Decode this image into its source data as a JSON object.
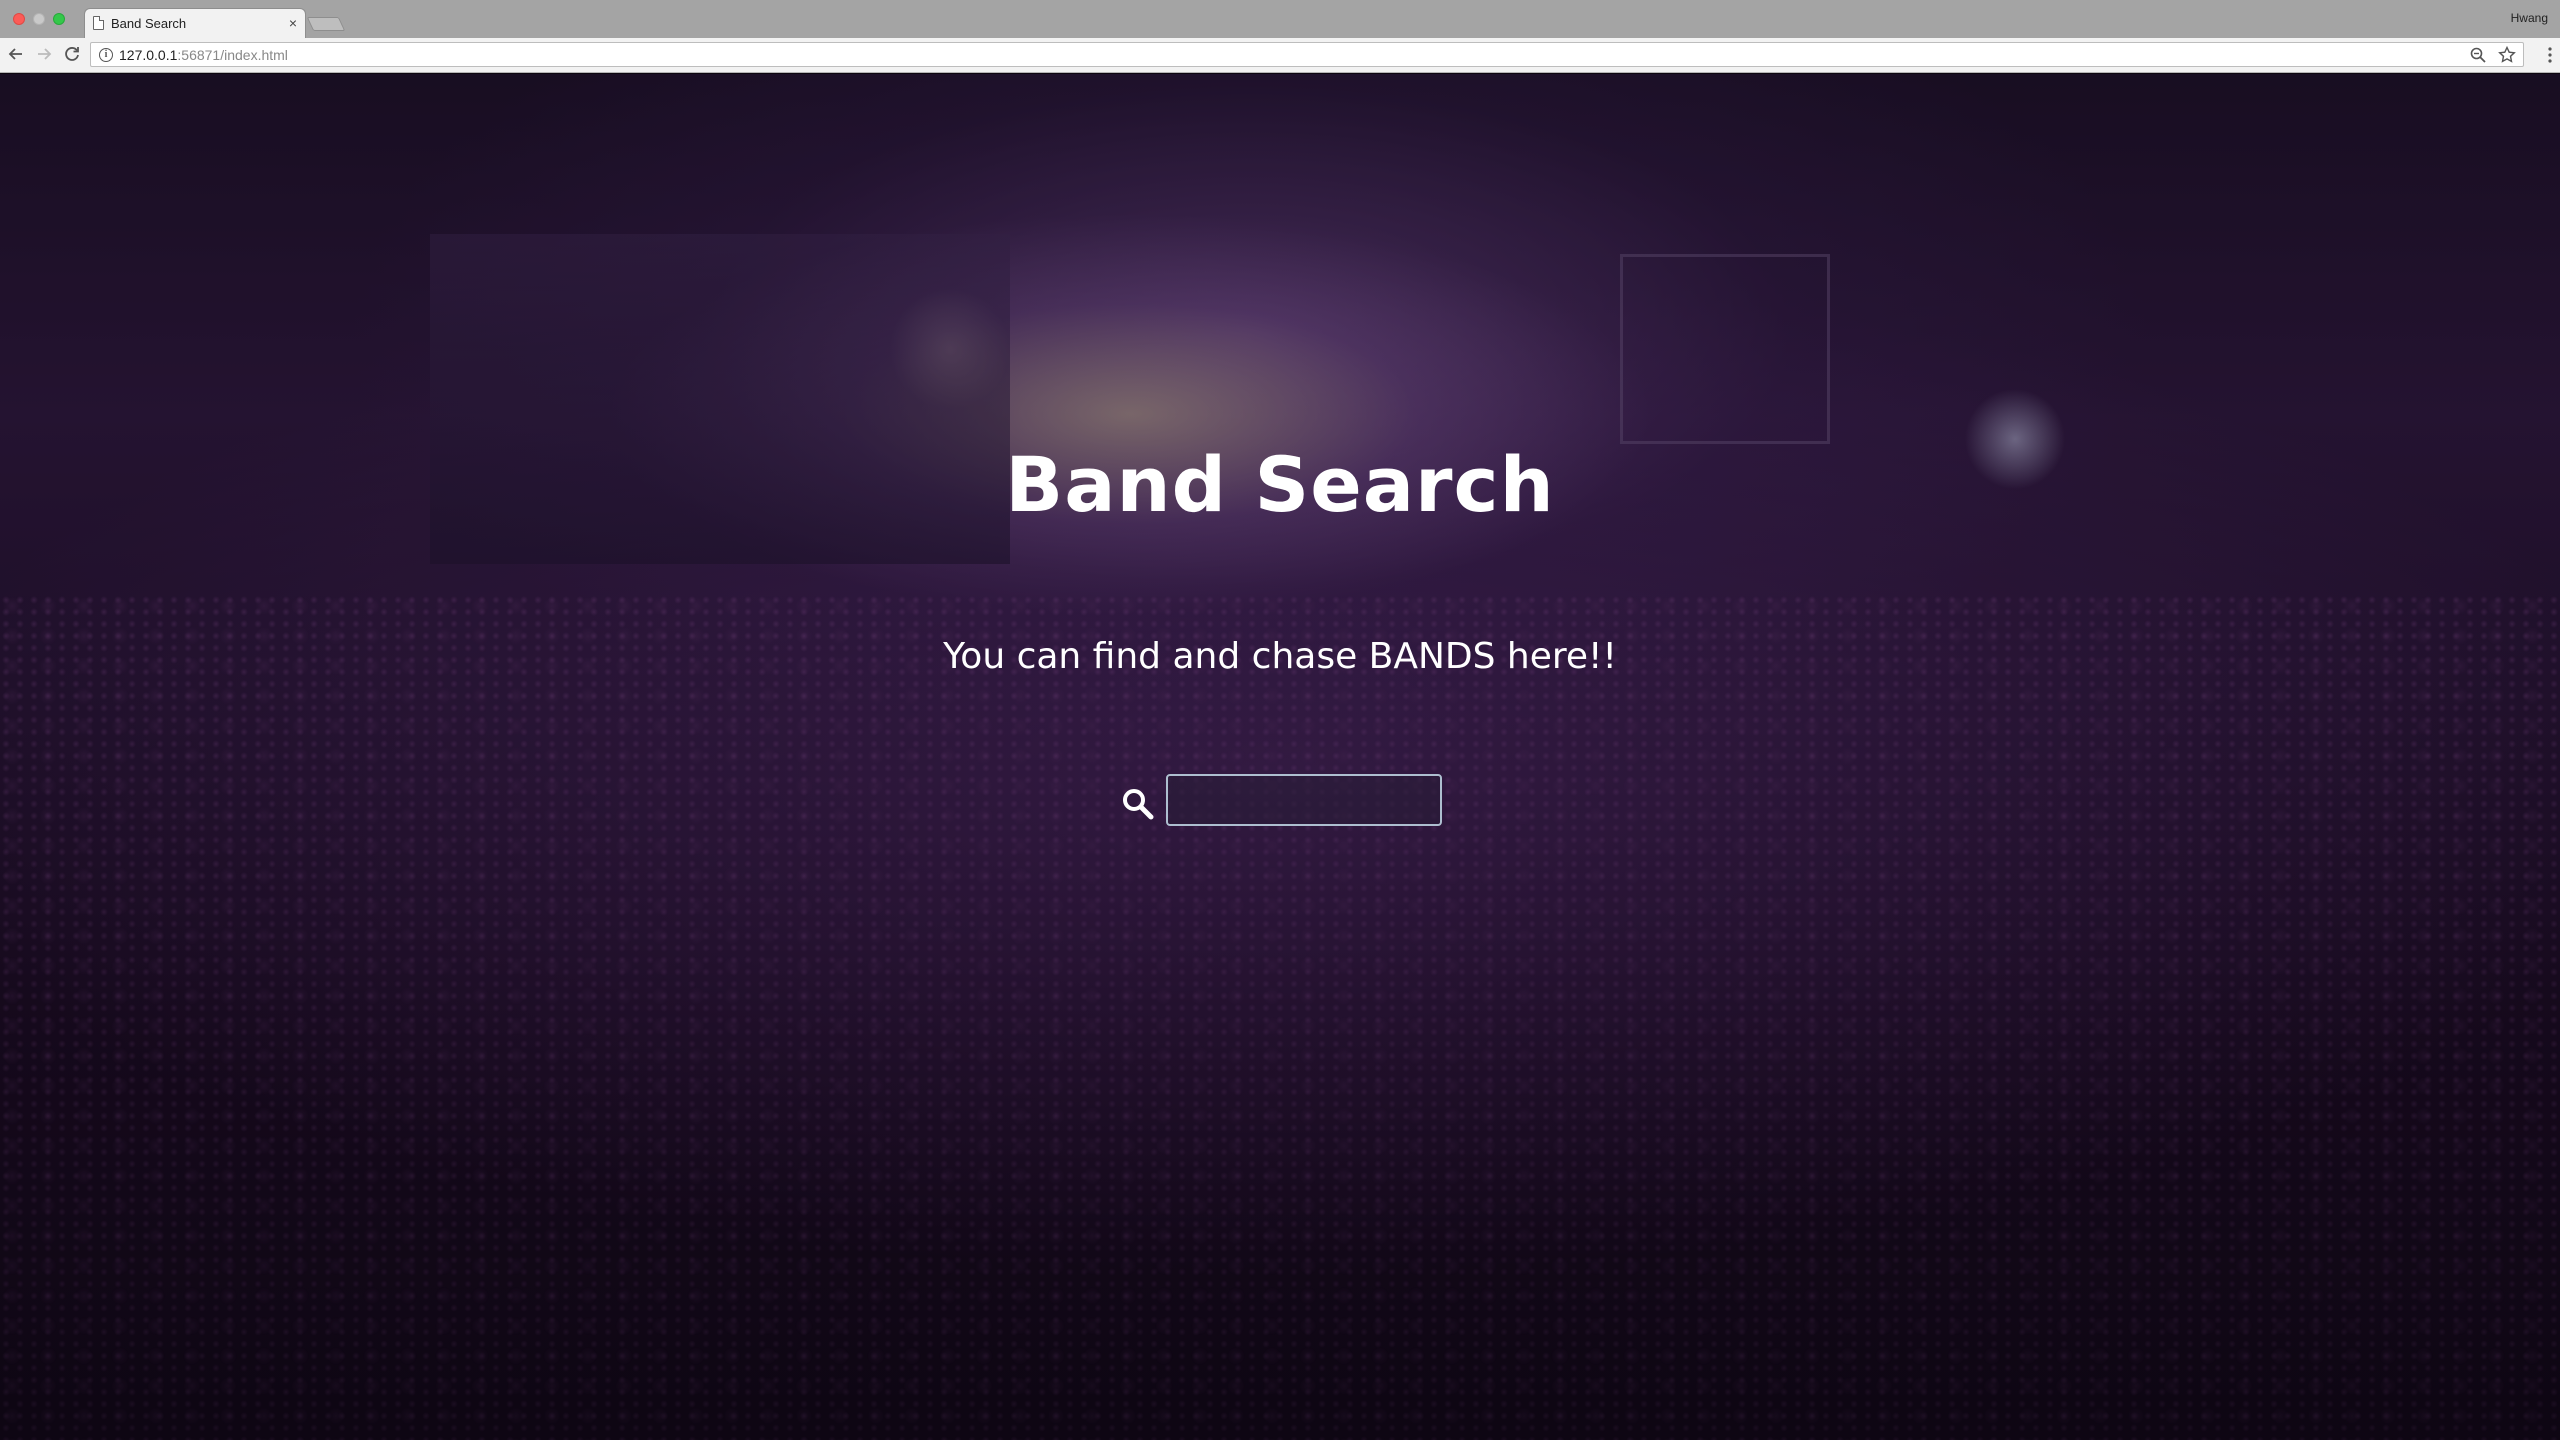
{
  "browser": {
    "tab_title": "Band Search",
    "tab_close_glyph": "×",
    "profile_name": "Hwang",
    "url_host": "127.0.0.1",
    "url_rest": ":56871/index.html",
    "info_glyph": "i"
  },
  "page": {
    "title": "Band Search",
    "subtitle": "You can find and chase BANDS here!!",
    "search": {
      "value": "",
      "placeholder": ""
    }
  }
}
